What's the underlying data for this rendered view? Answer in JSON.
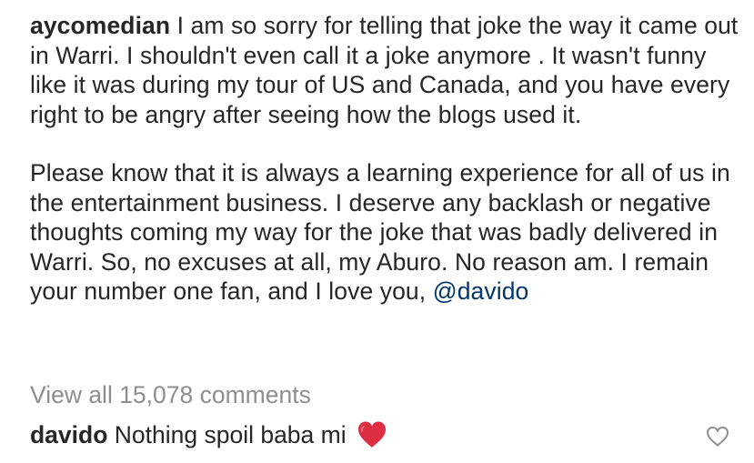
{
  "post": {
    "username": "aycomedian",
    "caption_para1": " I am so sorry for telling that joke the way it came out in Warri. I shouldn't even call it a joke anymore . It wasn't funny like it was during my tour of US and Canada, and you have every right to be angry after seeing how the blogs used it.",
    "caption_para2": "Please know that it is always a learning experience for all of us in the entertainment business. I deserve any backlash or negative thoughts coming my way for the joke that was badly delivered in Warri. So, no excuses at all, my Aburo. No reason am. I remain your number one fan, and  I love you, ",
    "mention": "@davido"
  },
  "comments_link": "View all 15,078 comments",
  "comment": {
    "username": "davido",
    "text": " Nothing spoil baba mi ",
    "emoji": "red-heart-emoji"
  },
  "icons": {
    "like": "heart-outline-icon"
  },
  "colors": {
    "text": "#262626",
    "secondary": "#8e8e8e",
    "mention": "#00376b",
    "heart": "#e0245e"
  }
}
